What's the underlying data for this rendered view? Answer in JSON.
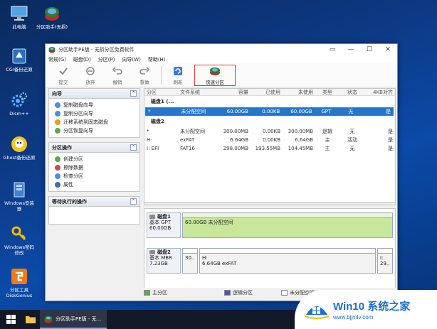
{
  "desktop": {
    "icons": [
      {
        "name": "此电脑"
      },
      {
        "name": "分区助手(无损)"
      },
      {
        "name": "CGI备份还原"
      },
      {
        "name": "Dism++"
      },
      {
        "name": "Ghost备份还原"
      },
      {
        "name": "Windows安装器"
      },
      {
        "name": "Windows密码修改"
      },
      {
        "name": "分区工具DiskGenius"
      }
    ]
  },
  "window": {
    "title": "分区助手PE版 - 无损分区免费软件",
    "controls": {
      "minimize": "—",
      "maximize": "☐",
      "close": "✕",
      "restore": "▭"
    }
  },
  "menu": [
    "常规(G)",
    "磁盘(D)",
    "分区(P)",
    "向导(W)",
    "帮助(H)"
  ],
  "toolbar": {
    "commit": "提交",
    "discard": "放弃",
    "undo": "撤销",
    "redo": "重做",
    "refresh": "刷新",
    "quick_partition": "快速分区"
  },
  "left": {
    "wizard_title": "向导",
    "wizard_items": [
      "复制磁盘向导",
      "复制分区向导",
      "迁移系统到固态磁盘",
      "分区恢复向导"
    ],
    "ops_title": "分区操作",
    "ops_items": [
      "创建分区",
      "擦除数据",
      "检查分区",
      "属性"
    ],
    "pending_title": "等待执行的操作",
    "collapse": "^"
  },
  "grid": {
    "headers": [
      "分区",
      "文件系统",
      "容量",
      "已使用",
      "未使用",
      "类型",
      "状态",
      "4KB对齐"
    ],
    "disk1_title": "磁盘1 (...",
    "disk1_rows": [
      [
        "*",
        "未分配空间",
        "60.00GB",
        "0.00KB",
        "60.00GB",
        "GPT",
        "无",
        "是"
      ]
    ],
    "disk2_title": "磁盘2",
    "disk2_rows": [
      [
        "*",
        "未分配空间",
        "300.00MB",
        "0.00KB",
        "300.00MB",
        "逻辑",
        "无",
        "是"
      ],
      [
        "H:",
        "exFAT",
        "6.64GB",
        "0.00KB",
        "6.64GB",
        "主",
        "活动",
        "是"
      ],
      [
        "I: EFI",
        "FAT16",
        "298.00MB",
        "193.55MB",
        "104.45MB",
        "主",
        "无",
        "是"
      ]
    ]
  },
  "map": {
    "disk1": {
      "title": "磁盘1",
      "line2": "基本 GPT",
      "line3": "60.00GB",
      "seg_text": "60.00GB 未分配空间"
    },
    "disk2": {
      "title": "磁盘2",
      "line2": "基本 MBR",
      "line3": "7.23GB",
      "seg1": "30..",
      "seg2_line1": "H:",
      "seg2_line2": "6.64GB exFAT",
      "seg3_line1": "I:",
      "seg3_line2": "29.."
    }
  },
  "legend": [
    "主分区",
    "逻辑分区",
    "未分配空间"
  ],
  "taskbar": {
    "task_label": "分区助手PE版 - 无..."
  },
  "watermark": {
    "title": "Win10 系统之家",
    "url": "www.bjjmlv.com"
  },
  "colors": {
    "accent": "#2a74c9",
    "highlight_box": "#e23b3b",
    "primary": "#5fa84b",
    "logical": "#4a55b5",
    "unallocated": "#c7e89a"
  }
}
